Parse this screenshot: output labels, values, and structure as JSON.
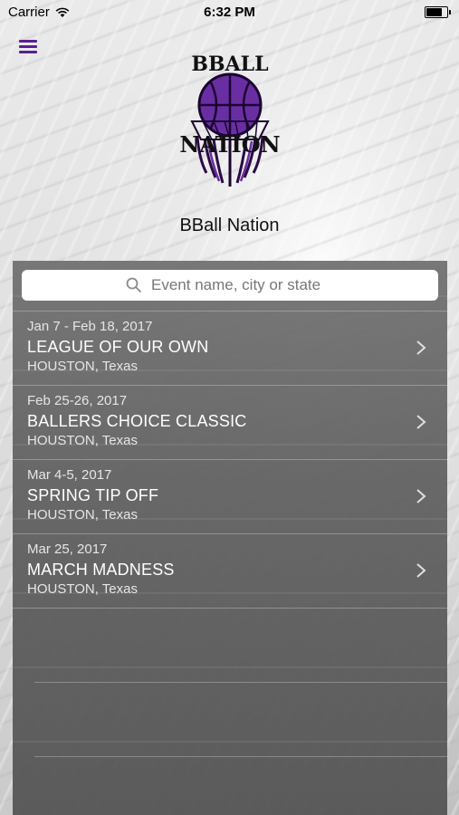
{
  "status_bar": {
    "carrier": "Carrier",
    "time": "6:32 PM",
    "battery_level": 0.85
  },
  "logo": {
    "line1": "BBALL",
    "line2": "NATION"
  },
  "app_title": "BBall Nation",
  "search": {
    "placeholder": "Event name, city or state",
    "value": ""
  },
  "events": [
    {
      "date": "Jan 7 - Feb 18, 2017",
      "name": "LEAGUE OF OUR OWN",
      "location": "HOUSTON, Texas"
    },
    {
      "date": "Feb 25-26, 2017",
      "name": "BALLERS CHOICE CLASSIC",
      "location": "HOUSTON, Texas"
    },
    {
      "date": "Mar 4-5, 2017",
      "name": "SPRING TIP OFF",
      "location": "HOUSTON, Texas"
    },
    {
      "date": "Mar 25, 2017",
      "name": "MARCH MADNESS",
      "location": "HOUSTON, Texas"
    }
  ],
  "colors": {
    "accent": "#5b1f91",
    "ball": "#6a2ea3"
  },
  "icons": {
    "menu": "hamburger-menu-icon",
    "search": "search-icon",
    "chevron": "chevron-right-icon",
    "wifi": "wifi-icon",
    "battery": "battery-icon"
  }
}
